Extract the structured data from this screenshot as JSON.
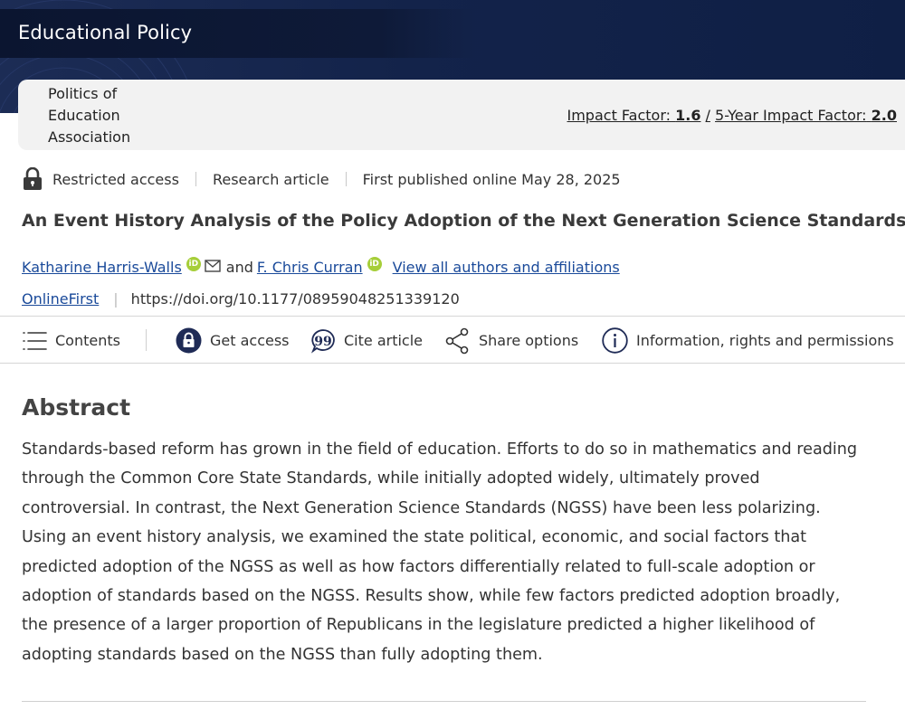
{
  "header": {
    "journal_name": "Educational Policy",
    "association": "Politics of Education Association",
    "impact_factor_label": "Impact Factor:",
    "impact_factor_value": "1.6",
    "impact_separator": "/",
    "five_year_label": "5-Year Impact Factor:",
    "five_year_value": "2.0"
  },
  "meta": {
    "access": "Restricted access",
    "article_type": "Research article",
    "published": "First published online May 28, 2025"
  },
  "article": {
    "title": "An Event History Analysis of the Policy Adoption of the Next Generation Science Standards",
    "authors": [
      {
        "name": "Katharine Harris-Walls",
        "orcid": "iD"
      },
      {
        "name": "F. Chris Curran",
        "orcid": "iD"
      }
    ],
    "and_text": "and",
    "view_all": "View all authors and affiliations",
    "online_first": "OnlineFirst",
    "doi": "https://doi.org/10.1177/08959048251339120"
  },
  "toolbar": {
    "contents": "Contents",
    "get_access": "Get access",
    "cite": "Cite article",
    "share": "Share options",
    "info": "Information, rights and permissions"
  },
  "abstract": {
    "heading": "Abstract",
    "text": "Standards-based reform has grown in the field of education. Efforts to do so in mathematics and reading through the Common Core State Standards, while initially adopted widely, ultimately proved controversial. In contrast, the Next Generation Science Standards (NGSS) have been less polarizing. Using an event history analysis, we examined the state political, economic, and social factors that predicted adoption of the NGSS as well as how factors differentially related to full-scale adoption or adoption of standards based on the NGSS. Results show, while few factors predicted adoption broadly, the presence of a larger proportion of Republicans in the legislature predicted a higher likelihood of adopting standards based on the NGSS than fully adopting them."
  },
  "icons": [
    "lock-icon",
    "orcid-icon",
    "mail-icon",
    "menu-icon",
    "lock-circle-icon",
    "quote-icon",
    "share-icon",
    "info-icon"
  ],
  "colors": {
    "header_bg": "#13234a",
    "journal_bar": "#0b1530",
    "card_bg": "#f2f2f2",
    "link": "#1a4a9a",
    "orcid": "#a6ce39",
    "access_icon": "#1f2b56"
  }
}
